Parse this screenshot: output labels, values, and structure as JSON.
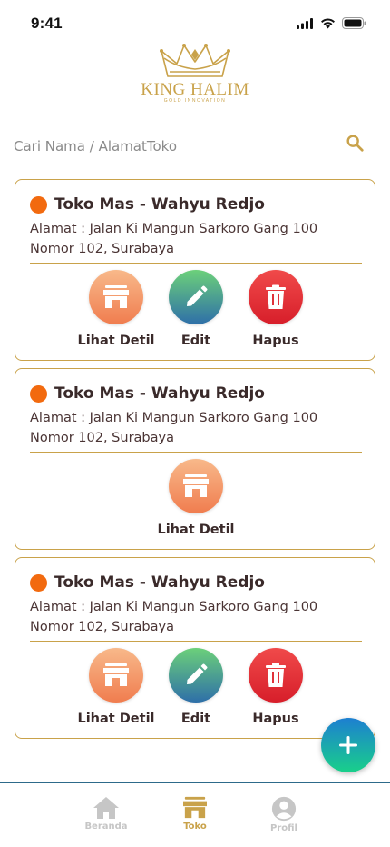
{
  "status_bar": {
    "time": "9:41"
  },
  "brand": {
    "name": "KING HALIM",
    "tagline": "GOLD INNOVATION"
  },
  "search": {
    "placeholder": "Cari Nama / AlamatToko"
  },
  "stores": [
    {
      "name": "Toko Mas - Wahyu Redjo",
      "address": "Alamat : Jalan Ki Mangun Sarkoro Gang 100 Nomor 102, Surabaya",
      "actions": [
        {
          "label": "Lihat Detil",
          "icon": "store-icon"
        },
        {
          "label": "Edit",
          "icon": "pencil-icon"
        },
        {
          "label": "Hapus",
          "icon": "trash-icon"
        }
      ]
    },
    {
      "name": "Toko Mas - Wahyu Redjo",
      "address": "Alamat : Jalan Ki Mangun Sarkoro Gang 100 Nomor 102, Surabaya",
      "actions": [
        {
          "label": "Lihat Detil",
          "icon": "store-icon"
        }
      ]
    },
    {
      "name": "Toko Mas - Wahyu Redjo",
      "address": "Alamat : Jalan Ki Mangun Sarkoro Gang 100 Nomor 102, Surabaya",
      "actions": [
        {
          "label": "Lihat Detil",
          "icon": "store-icon"
        },
        {
          "label": "Edit",
          "icon": "pencil-icon"
        },
        {
          "label": "Hapus",
          "icon": "trash-icon"
        }
      ]
    }
  ],
  "fab": {
    "icon": "plus-icon"
  },
  "nav": {
    "items": [
      {
        "label": "Beranda",
        "icon": "home-icon",
        "active": false
      },
      {
        "label": "Toko",
        "icon": "store-icon",
        "active": true
      },
      {
        "label": "Profil",
        "icon": "user-icon",
        "active": false
      }
    ]
  },
  "colors": {
    "accent_gold": "#c9a24a",
    "status_dot": "#f26a0f",
    "detail_button": "#f07d4f",
    "edit_button": "#2e6fa8",
    "delete_button": "#d71e2a",
    "fab": "#19d08a"
  }
}
